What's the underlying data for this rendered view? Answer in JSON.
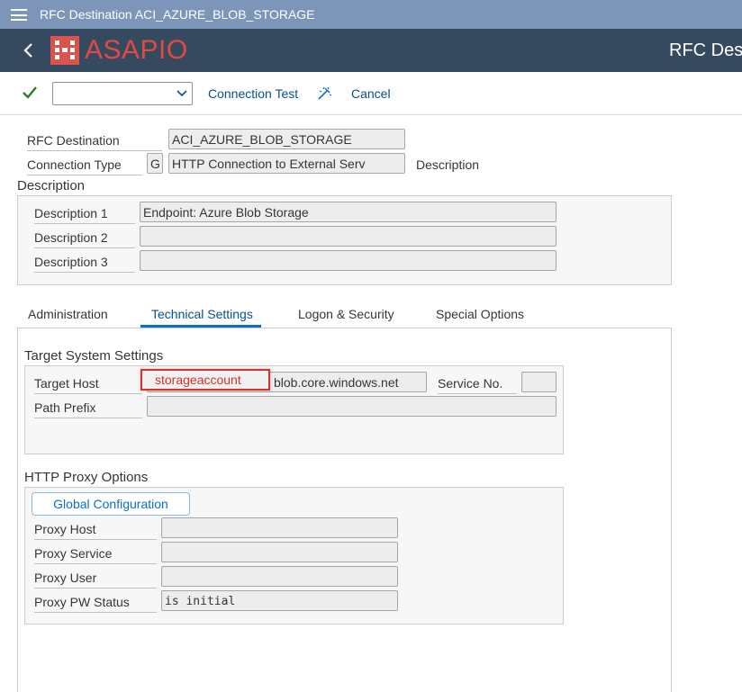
{
  "window": {
    "title": "RFC Destination ACI_AZURE_BLOB_STORAGE"
  },
  "shell": {
    "logo_text": "ASAPIO",
    "title": "RFC Des"
  },
  "toolbar": {
    "select_value": "",
    "connection_test_label": "Connection Test",
    "cancel_label": "Cancel"
  },
  "header": {
    "rfc_destination_label": "RFC Destination",
    "rfc_destination_value": "ACI_AZURE_BLOB_STORAGE",
    "connection_type_label": "Connection Type",
    "connection_type_code": "G",
    "connection_type_value": "HTTP Connection to External Serv",
    "description_link": "Description"
  },
  "description": {
    "title": "Description",
    "rows": [
      {
        "label": "Description 1",
        "value": "Endpoint: Azure Blob Storage"
      },
      {
        "label": "Description 2",
        "value": ""
      },
      {
        "label": "Description 3",
        "value": ""
      }
    ]
  },
  "tabs": [
    {
      "label": "Administration"
    },
    {
      "label": "Technical Settings"
    },
    {
      "label": "Logon & Security"
    },
    {
      "label": "Special Options"
    }
  ],
  "target_system": {
    "title": "Target System Settings",
    "target_host_label": "Target Host",
    "target_host_value": "blob.core.windows.net",
    "redacted_text": "storageaccount",
    "service_no_label": "Service No.",
    "service_no_value": "",
    "path_prefix_label": "Path Prefix",
    "path_prefix_value": ""
  },
  "proxy": {
    "title": "HTTP Proxy Options",
    "global_config_label": "Global Configuration",
    "rows": [
      {
        "label": "Proxy Host",
        "value": ""
      },
      {
        "label": "Proxy Service",
        "value": ""
      },
      {
        "label": "Proxy User",
        "value": ""
      },
      {
        "label": "Proxy PW Status",
        "value": "is initial"
      }
    ]
  },
  "colors": {
    "titlebar": "#7d95b8",
    "shellbar": "#354a5f",
    "brand": "#e04a45",
    "link": "#0a4e8c",
    "accent": "#0a6ed1",
    "check": "#2b7d2b"
  }
}
